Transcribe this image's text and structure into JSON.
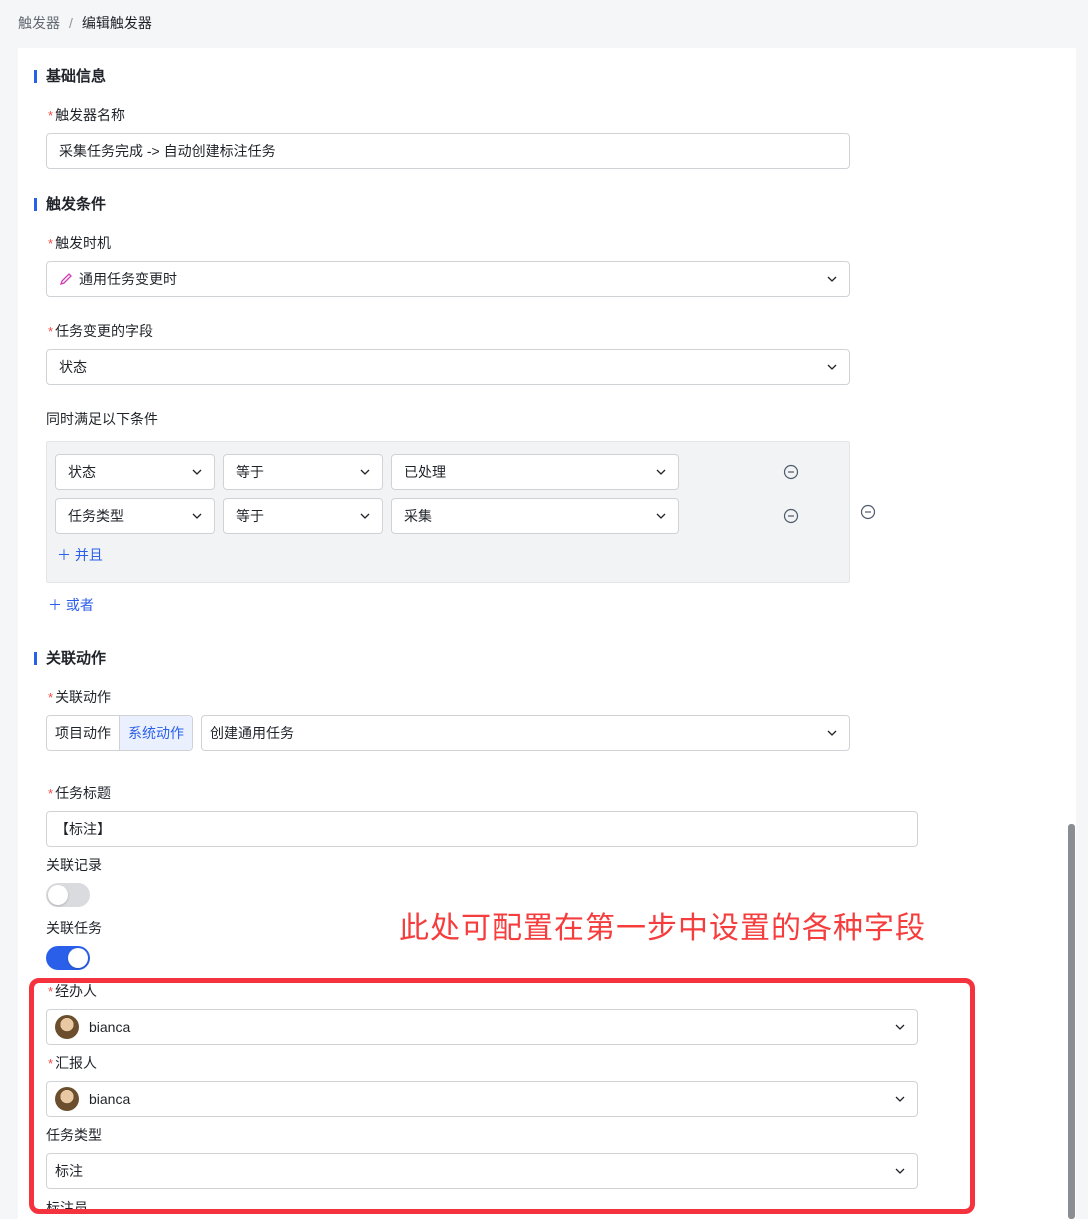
{
  "breadcrumb": {
    "parent": "触发器",
    "separator": "/",
    "current": "编辑触发器"
  },
  "sections": {
    "basic": "基础信息",
    "condition": "触发条件",
    "action": "关联动作"
  },
  "basic": {
    "name_label": "触发器名称",
    "name_value": "采集任务完成 -> 自动创建标注任务"
  },
  "condition": {
    "timing_label": "触发时机",
    "timing_value": "通用任务变更时",
    "field_label": "任务变更的字段",
    "field_value": "状态",
    "rules_label": "同时满足以下条件",
    "rows": [
      {
        "field": "状态",
        "op": "等于",
        "value": "已处理"
      },
      {
        "field": "任务类型",
        "op": "等于",
        "value": "采集"
      }
    ],
    "and_label": "并且",
    "or_label": "或者"
  },
  "action": {
    "label": "关联动作",
    "tabs": [
      "项目动作",
      "系统动作"
    ],
    "active_tab": "系统动作",
    "action_value": "创建通用任务",
    "title_label": "任务标题",
    "title_value": "【标注】",
    "link_record_label": "关联记录",
    "link_record_on": false,
    "link_task_label": "关联任务",
    "link_task_on": true,
    "assignee_label": "经办人",
    "assignee_value": "bianca",
    "reporter_label": "汇报人",
    "reporter_value": "bianca",
    "type_label": "任务类型",
    "type_value": "标注",
    "next_label": "标注员"
  },
  "annotation": "此处可配置在第一步中设置的各种字段",
  "colors": {
    "accent": "#2a5fe9",
    "required": "#f54a45",
    "annotation": "#f5333f",
    "timing_icon": "#d13cb4"
  }
}
